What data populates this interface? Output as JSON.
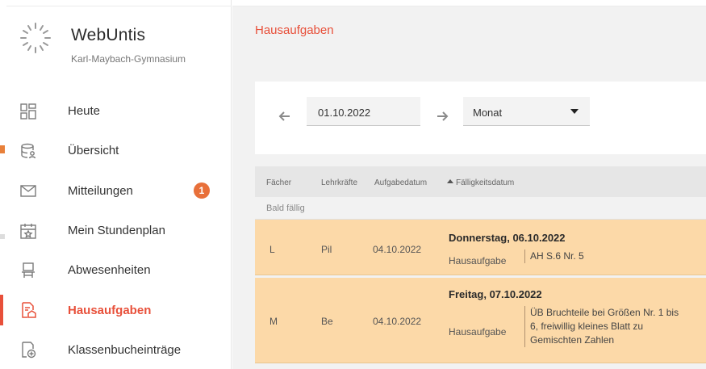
{
  "app": {
    "name": "WebUntis",
    "school": "Karl-Maybach-Gymnasium"
  },
  "sidebar": {
    "items": [
      {
        "label": "Heute",
        "icon": "dashboard-icon",
        "active": false
      },
      {
        "label": "Übersicht",
        "icon": "database-user-icon",
        "active": false
      },
      {
        "label": "Mitteilungen",
        "icon": "envelope-icon",
        "active": false,
        "badge": "1"
      },
      {
        "label": "Mein Stundenplan",
        "icon": "calendar-icon",
        "active": false
      },
      {
        "label": "Abwesenheiten",
        "icon": "chair-icon",
        "active": false
      },
      {
        "label": "Hausaufgaben",
        "icon": "homework-icon",
        "active": true
      },
      {
        "label": "Klassenbucheinträge",
        "icon": "classbook-add-icon",
        "active": false
      }
    ]
  },
  "page": {
    "title": "Hausaufgaben"
  },
  "filter": {
    "date": "01.10.2022",
    "period": "Monat"
  },
  "table": {
    "headers": {
      "subject": "Fächer",
      "teachers": "Lehrkräfte",
      "assigned": "Aufgabedatum",
      "due": "Fälligkeitsdatum"
    },
    "group_label": "Bald fällig",
    "rows": [
      {
        "subject": "L",
        "teacher": "Pil",
        "assigned": "04.10.2022",
        "due": "Donnerstag, 06.10.2022",
        "type": "Hausaufgabe",
        "description_lines": [
          "AH S.6 Nr. 5"
        ]
      },
      {
        "subject": "M",
        "teacher": "Be",
        "assigned": "04.10.2022",
        "due": "Freitag, 07.10.2022",
        "type": "Hausaufgabe",
        "description_lines": [
          "ÜB Bruchteile bei Größen Nr. 1 bis",
          "6, freiwillig kleines Blatt zu",
          "Gemischten Zahlen"
        ]
      }
    ]
  },
  "colors": {
    "accent": "#e8503a",
    "row_highlight": "#fcd9a8",
    "badge": "#e8703a"
  }
}
